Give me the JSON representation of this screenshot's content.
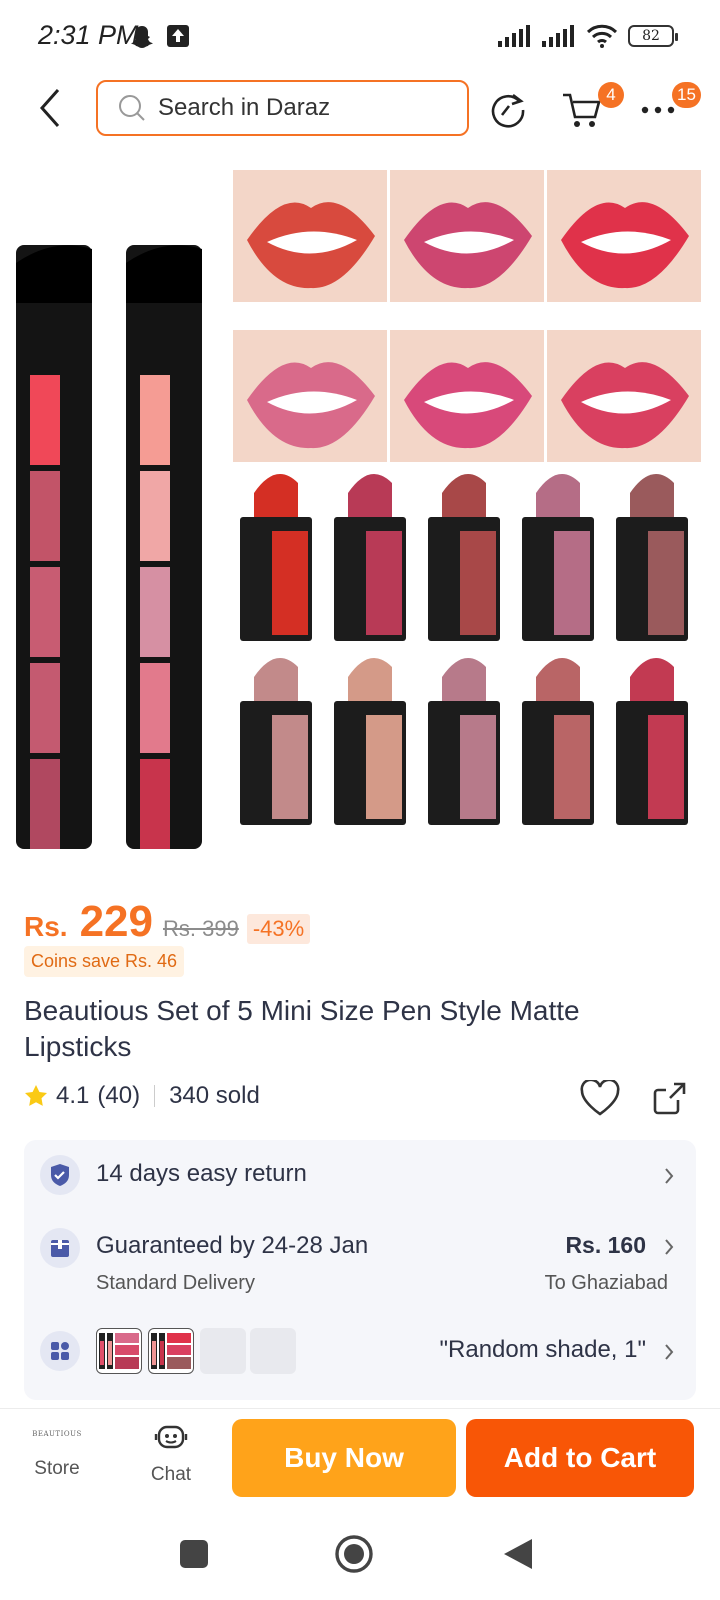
{
  "status_bar": {
    "time": "2:31 PM",
    "battery": "82"
  },
  "header": {
    "search_placeholder": "Search in Daraz",
    "cart_badge": "4",
    "more_badge": "15"
  },
  "product": {
    "currency": "Rs.",
    "price": "229",
    "original_price": "Rs. 399",
    "discount": "-43%",
    "coins": "Coins save Rs. 46",
    "title": "Beautious Set of 5 Mini Size Pen Style Matte Lipsticks",
    "rating": "4.1",
    "reviews": "(40)",
    "sold": "340 sold"
  },
  "info": {
    "return_text": "14 days easy return",
    "delivery_text": "Guaranteed by 24-28 Jan",
    "delivery_type": "Standard Delivery",
    "delivery_price": "Rs. 160",
    "delivery_location": "To Ghaziabad",
    "variant_text": "\"Random shade, 1\""
  },
  "bottom_bar": {
    "store_logo": "BEAUTIOUS",
    "store_label": "Store",
    "chat_label": "Chat",
    "buy_now": "Buy Now",
    "add_to_cart": "Add to Cart"
  },
  "colors": {
    "accent": "#f57224",
    "buy_now": "#ffa31a",
    "add_to_cart": "#f85606"
  },
  "lip_swatches": [
    "#d84a3e",
    "#cd4670",
    "#e0324a",
    "#d96a8a",
    "#d8497a",
    "#d94060"
  ],
  "lipstick_colors": [
    "#d42f24",
    "#b83a56",
    "#a84848",
    "#b56d86",
    "#9a5a5c",
    "#c28a8a",
    "#d49a88",
    "#b77a8a",
    "#b96566",
    "#c23a52"
  ],
  "pen_colors": [
    "#f04858",
    "#c25468",
    "#c85c72",
    "#c45a70",
    "#b04860"
  ],
  "pen2_colors": [
    "#f59c94",
    "#f0a7a6",
    "#d690a3",
    "#e27a8c",
    "#c8344c"
  ]
}
